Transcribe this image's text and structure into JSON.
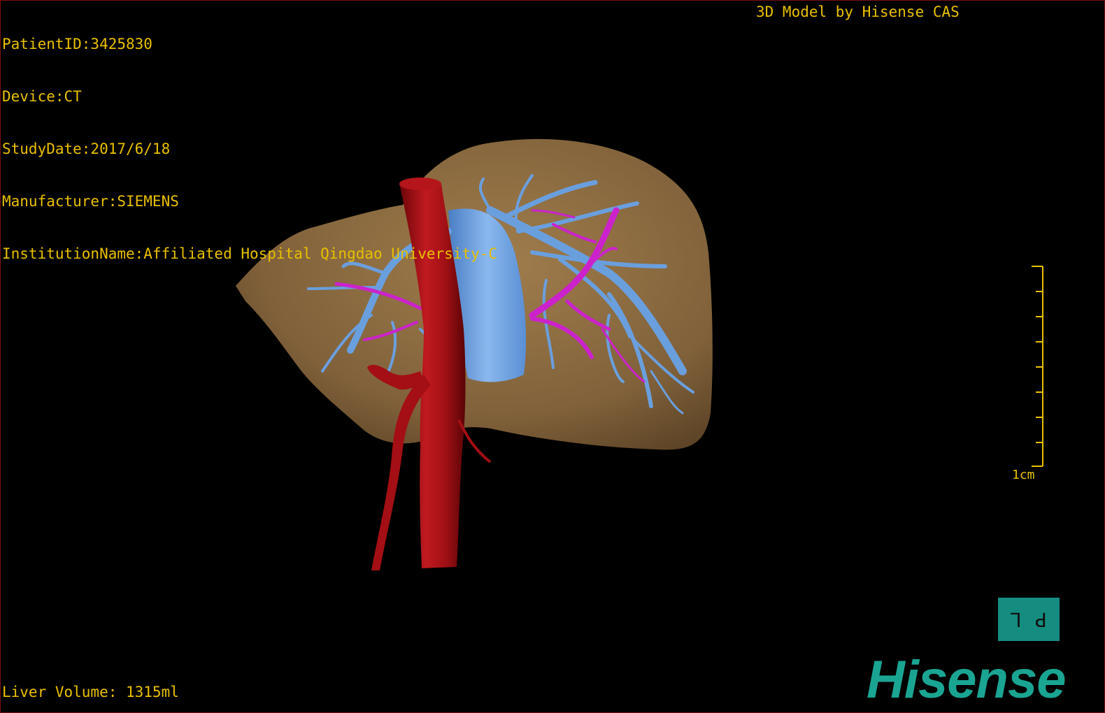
{
  "info": {
    "patient_id": "PatientID:3425830",
    "device": "Device:CT",
    "study_date": "StudyDate:2017/6/18",
    "manufacturer": "Manufacturer:SIEMENS",
    "institution": "InstitutionName:Affiliated Hospital Qingdao University-C"
  },
  "credit": "3D Model by Hisense CAS",
  "scale": {
    "label": "1cm",
    "ticks": 9
  },
  "volume": "Liver Volume: 1315ml",
  "orientation": {
    "left": "L",
    "right": "P",
    "icon": "orientation-cube-icon"
  },
  "logo": "Hisense",
  "colors": {
    "text": "#e8c000",
    "liver": "#8a6a40",
    "artery": "#a80f14",
    "portal_vein": "#6a9fde",
    "hepatic_artery_branches": "#cc22cc",
    "brand": "#1aa593"
  }
}
